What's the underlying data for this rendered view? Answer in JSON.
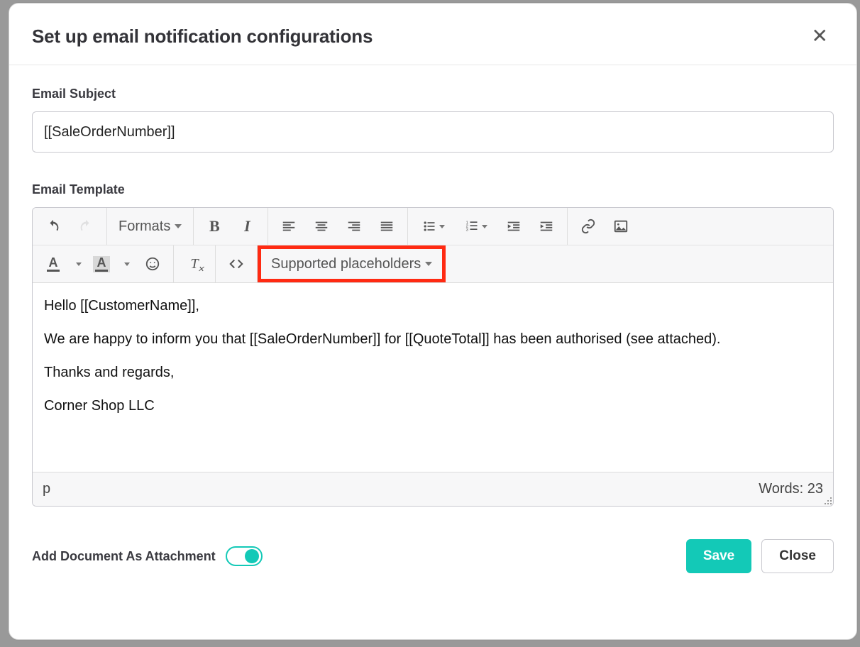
{
  "modal": {
    "title": "Set up email notification configurations"
  },
  "subject": {
    "label": "Email Subject",
    "value": "[[SaleOrderNumber]]"
  },
  "template": {
    "label": "Email Template"
  },
  "toolbar": {
    "formats_label": "Formats",
    "placeholders_label": "Supported placeholders"
  },
  "body": {
    "p1": "Hello [[CustomerName]],",
    "p2": "We are happy to inform you that [[SaleOrderNumber]] for [[QuoteTotal]] has been authorised (see attached).",
    "p3": "Thanks and regards,",
    "p4": "Corner Shop LLC"
  },
  "status": {
    "path": "p",
    "wordcount": "Words: 23"
  },
  "footer": {
    "attach_label": "Add Document As Attachment",
    "save_label": "Save",
    "close_label": "Close"
  }
}
